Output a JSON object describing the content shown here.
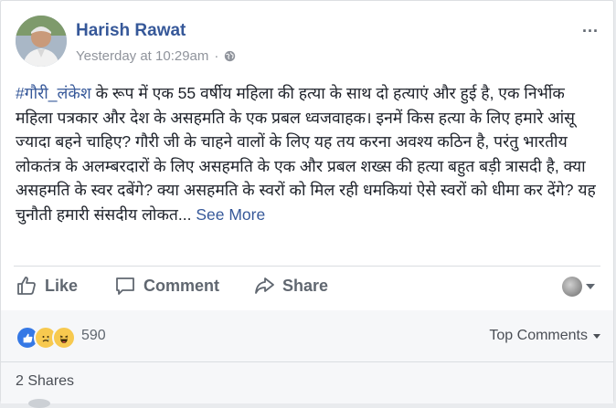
{
  "post": {
    "author": "Harish Rawat",
    "timestamp": "Yesterday at 10:29am",
    "hashtag": "#गौरी_लंकेश",
    "body": " के रूप में एक 55 वर्षीय महिला की हत्या के साथ दो हत्याएं और हुई है, एक निर्भीक महिला पत्रकार और देश के असहमति के एक प्रबल ध्वजवाहक। इनमें किस हत्या के लिए हमारे आंसू ज्यादा बहने चाहिए? गौरी जी के चाहने वालों के लिए यह तय करना अवश्य कठिन है, परंतु भारतीय लोकतंत्र के अलम्बरदारों के लिए असहमति के एक और प्रबल शख्स की हत्या बहुत बड़ी त्रासदी है, क्या असहमति के स्वर दबेंगे? क्या असहमति के स्वरों को मिल रही धमकियां ऐसे स्वरों को धीमा कर देंगे? यह चुनौती हमारी संसदीय लोकत...",
    "see_more": "See More",
    "more_icon": "..."
  },
  "actions": {
    "like": "Like",
    "comment": "Comment",
    "share": "Share"
  },
  "reactions": {
    "icons": [
      "like-reaction-icon",
      "sad-reaction-icon",
      "haha-reaction-icon"
    ],
    "count": "590",
    "sort_label": "Top Comments"
  },
  "shares": {
    "label": "2 Shares"
  },
  "colors": {
    "link": "#365899",
    "secondary": "#90949c",
    "action": "#606770"
  }
}
